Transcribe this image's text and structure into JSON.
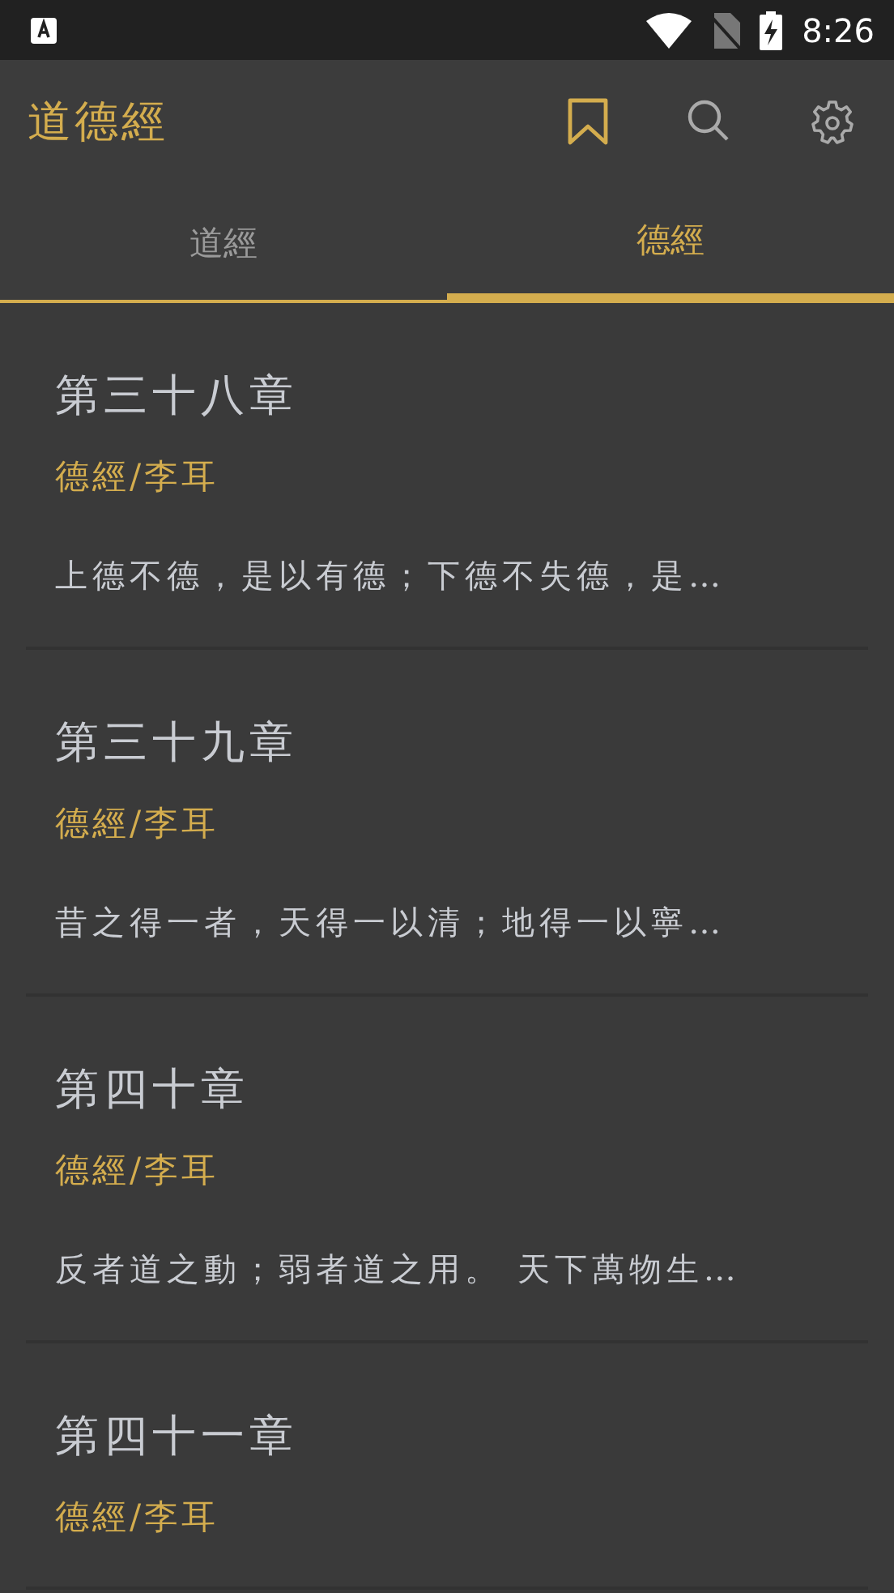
{
  "status_bar": {
    "time": "8:26"
  },
  "app_bar": {
    "title": "道德經"
  },
  "tabs": [
    {
      "label": "道經",
      "selected": false
    },
    {
      "label": "德經",
      "selected": true
    }
  ],
  "chapters": [
    {
      "title": "第三十八章",
      "source": "德經/李耳",
      "excerpt": "上德不德，是以有德；下德不失德，是…"
    },
    {
      "title": "第三十九章",
      "source": "德經/李耳",
      "excerpt": "昔之得一者，天得一以清；地得一以寧…"
    },
    {
      "title": "第四十章",
      "source": "德經/李耳",
      "excerpt": "反者道之動；弱者道之用。 天下萬物生…"
    },
    {
      "title": "第四十一章",
      "source": "德經/李耳"
    }
  ]
}
